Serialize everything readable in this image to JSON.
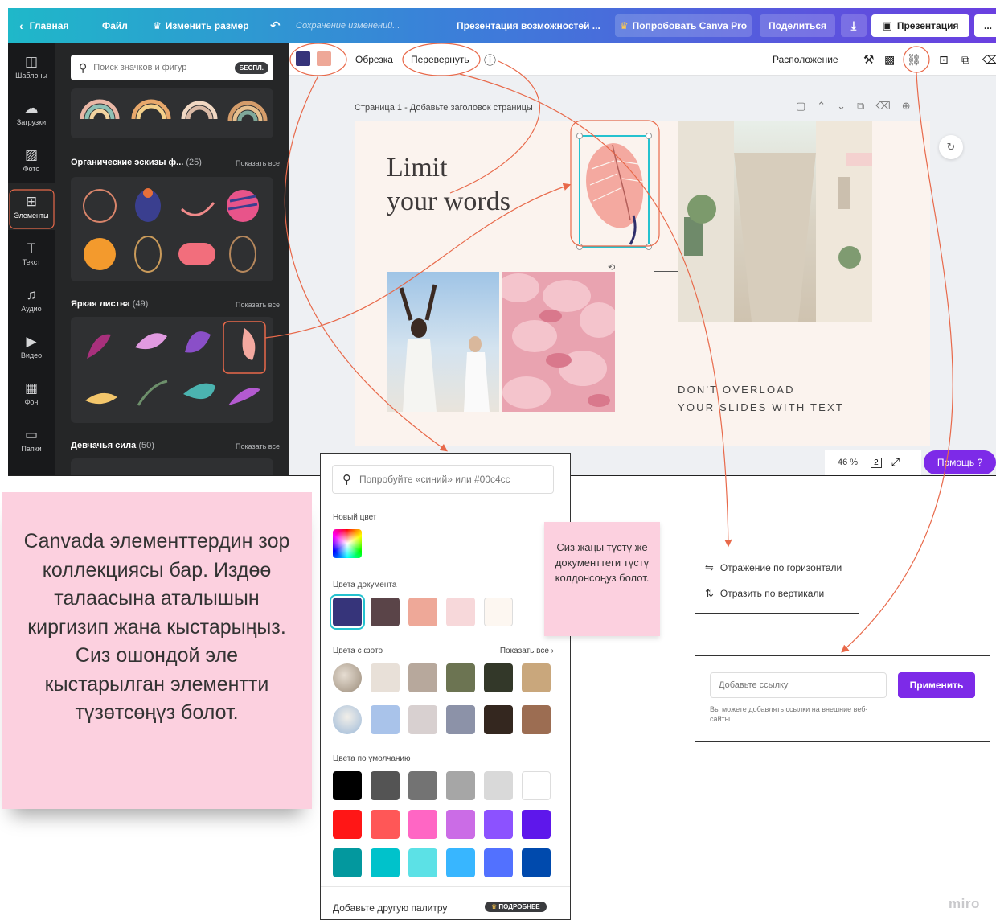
{
  "topbar": {
    "home": "Главная",
    "file": "Файл",
    "resize": "Изменить размер",
    "saving": "Сохранение изменений...",
    "doc_title": "Презентация возможностей ...",
    "try_pro": "Попробовать Canva Pro",
    "share": "Поделиться",
    "present": "Презентация",
    "more": "..."
  },
  "rail": [
    {
      "icon": "templates-icon",
      "label": "Шаблоны"
    },
    {
      "icon": "upload-icon",
      "label": "Загрузки"
    },
    {
      "icon": "photo-icon",
      "label": "Фото"
    },
    {
      "icon": "elements-icon",
      "label": "Элементы"
    },
    {
      "icon": "text-icon",
      "label": "Текст"
    },
    {
      "icon": "audio-icon",
      "label": "Аудио"
    },
    {
      "icon": "video-icon",
      "label": "Видео"
    },
    {
      "icon": "background-icon",
      "label": "Фон"
    },
    {
      "icon": "folder-icon",
      "label": "Папки"
    }
  ],
  "panel": {
    "search_placeholder": "Поиск значков и фигур",
    "free_badge": "БЕСПЛ.",
    "sections": [
      {
        "title": "Органические эскизы ф...",
        "count": "(25)",
        "show_all": "Показать все"
      },
      {
        "title": "Яркая листва",
        "count": "(49)",
        "show_all": "Показать все"
      },
      {
        "title": "Девчачья сила",
        "count": "(50)",
        "show_all": "Показать все"
      }
    ]
  },
  "context_bar": {
    "crop": "Обрезка",
    "flip": "Перевернуть",
    "position": "Расположение"
  },
  "page": {
    "label": "Страница 1 - Добавьте заголовок страницы"
  },
  "slide": {
    "title_line1": "Limit",
    "title_line2": "your words",
    "caption_line1": "DON'T OVERLOAD",
    "caption_line2": "YOUR SLIDES WITH TEXT"
  },
  "footer": {
    "zoom": "46 %",
    "page_count": "2",
    "help": "Помощь ?"
  },
  "note_pink": {
    "text": "Canvada элементтердин зор коллекциясы бар. Издөө талаасына аталышын киргизип жана кыстарыңыз. Сиз ошондой эле кыстарылган элементти түзөтсөңүз болот."
  },
  "color_picker": {
    "search_placeholder": "Попробуйте «синий» или #00c4cc",
    "new_color": "Новый цвет",
    "doc_colors": "Цвета документа",
    "photo_colors": "Цвета с фото",
    "show_all": "Показать все",
    "default_colors": "Цвета по умолчанию",
    "add_palette": "Добавьте другую палитру",
    "more_badge": "ПОДРОБНЕЕ",
    "document_swatches": [
      "#36347a",
      "#5a4448",
      "#eea898",
      "#f7d8da",
      "#fdf7f1"
    ],
    "photo_row1": [
      "#e8e0d8",
      "#b7a89c",
      "#6c7452",
      "#333829",
      "#c9a77c"
    ],
    "photo_row2": [
      "#a9c3ea",
      "#d8d0d0",
      "#8c92a8",
      "#34271f",
      "#9c6d52"
    ],
    "default_swatches": [
      [
        "#000000",
        "#545454",
        "#737373",
        "#a6a6a6",
        "#d9d9d9",
        "#ffffff"
      ],
      [
        "#ff1616",
        "#ff5757",
        "#ff66c4",
        "#cb6ce6",
        "#8c52ff",
        "#5e17eb"
      ],
      [
        "#03989e",
        "#00c2cb",
        "#5ce1e6",
        "#38b6ff",
        "#5271ff",
        "#004aad"
      ]
    ]
  },
  "sticky": {
    "text": "Сиз жаңы түстү же документтеги түстү колдонсоңуз болот."
  },
  "flip_menu": {
    "horizontal": "Отражение по горизонтали",
    "vertical": "Отразить по вертикали"
  },
  "link_box": {
    "placeholder": "Добавьте ссылку",
    "apply": "Применить",
    "hint": "Вы можете добавлять ссылки на внешние веб-сайты."
  },
  "watermark": "miro",
  "colors": {
    "annotation": "#e8694a",
    "accent_purple": "#7d2ae8",
    "note_pink": "#fcd0df"
  }
}
